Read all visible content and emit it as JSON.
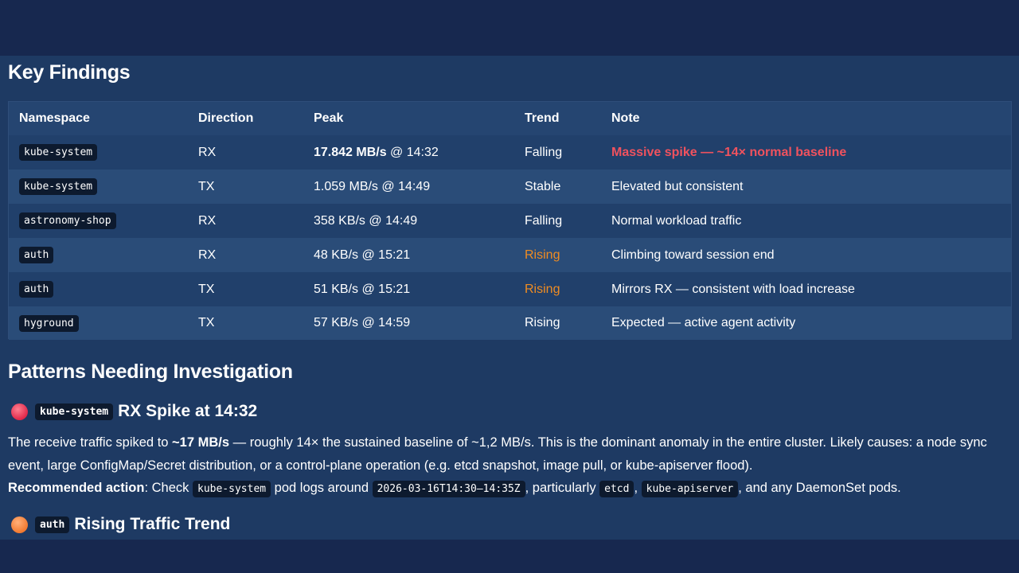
{
  "findings": {
    "title": "Key Findings",
    "columns": [
      "Namespace",
      "Direction",
      "Peak",
      "Trend",
      "Note"
    ],
    "rows": [
      {
        "namespace": "kube-system",
        "direction": "RX",
        "peak_value": "17.842 MB/s",
        "peak_time": " @ 14:32",
        "trend": "Falling",
        "note": "Massive spike — ~14× normal baseline"
      },
      {
        "namespace": "kube-system",
        "direction": "TX",
        "peak_value": "1.059 MB/s",
        "peak_time": " @ 14:49",
        "trend": "Stable",
        "note": "Elevated but consistent"
      },
      {
        "namespace": "astronomy-shop",
        "direction": "RX",
        "peak_value": "358 KB/s",
        "peak_time": " @ 14:49",
        "trend": "Falling",
        "note": "Normal workload traffic"
      },
      {
        "namespace": "auth",
        "direction": "RX",
        "peak_value": "48 KB/s",
        "peak_time": " @ 15:21",
        "trend": "Rising",
        "note": "Climbing toward session end"
      },
      {
        "namespace": "auth",
        "direction": "TX",
        "peak_value": "51 KB/s",
        "peak_time": " @ 15:21",
        "trend": "Rising",
        "note": "Mirrors RX — consistent with load increase"
      },
      {
        "namespace": "hyground",
        "direction": "TX",
        "peak_value": "57 KB/s",
        "peak_time": " @ 14:59",
        "trend": "Rising",
        "note": "Expected — active agent activity"
      }
    ]
  },
  "patterns": {
    "title": "Patterns Needing Investigation",
    "items": [
      {
        "namespace": "kube-system",
        "heading": "RX Spike at 14:32",
        "line1_pre": "The receive traffic spiked to ",
        "line1_bold": "~17 MB/s",
        "line1_post": " — roughly 14× the sustained baseline of ~1,2 MB/s. This is the dominant anomaly in the entire cluster. Likely causes: a node sync event, large ConfigMap/Secret distribution, or a control-plane operation (e.g. etcd snapshot, image pull, or kube-apiserver flood).",
        "action_label": "Recommended action",
        "action_pre": ": Check ",
        "action_code1": "kube-system",
        "action_mid1": " pod logs around ",
        "action_code2": "2026-03-16T14:30–14:35Z",
        "action_mid2": ", particularly ",
        "action_code3": "etcd",
        "action_mid3": ", ",
        "action_code4": "kube-apiserver",
        "action_post": ", and any DaemonSet pods."
      },
      {
        "namespace": "auth",
        "heading": "Rising Traffic Trend"
      }
    ]
  },
  "colors": {
    "alert_red": "#f0525e",
    "rising_orange": "#ef8c22",
    "panel_bg": "#1e3a63"
  }
}
